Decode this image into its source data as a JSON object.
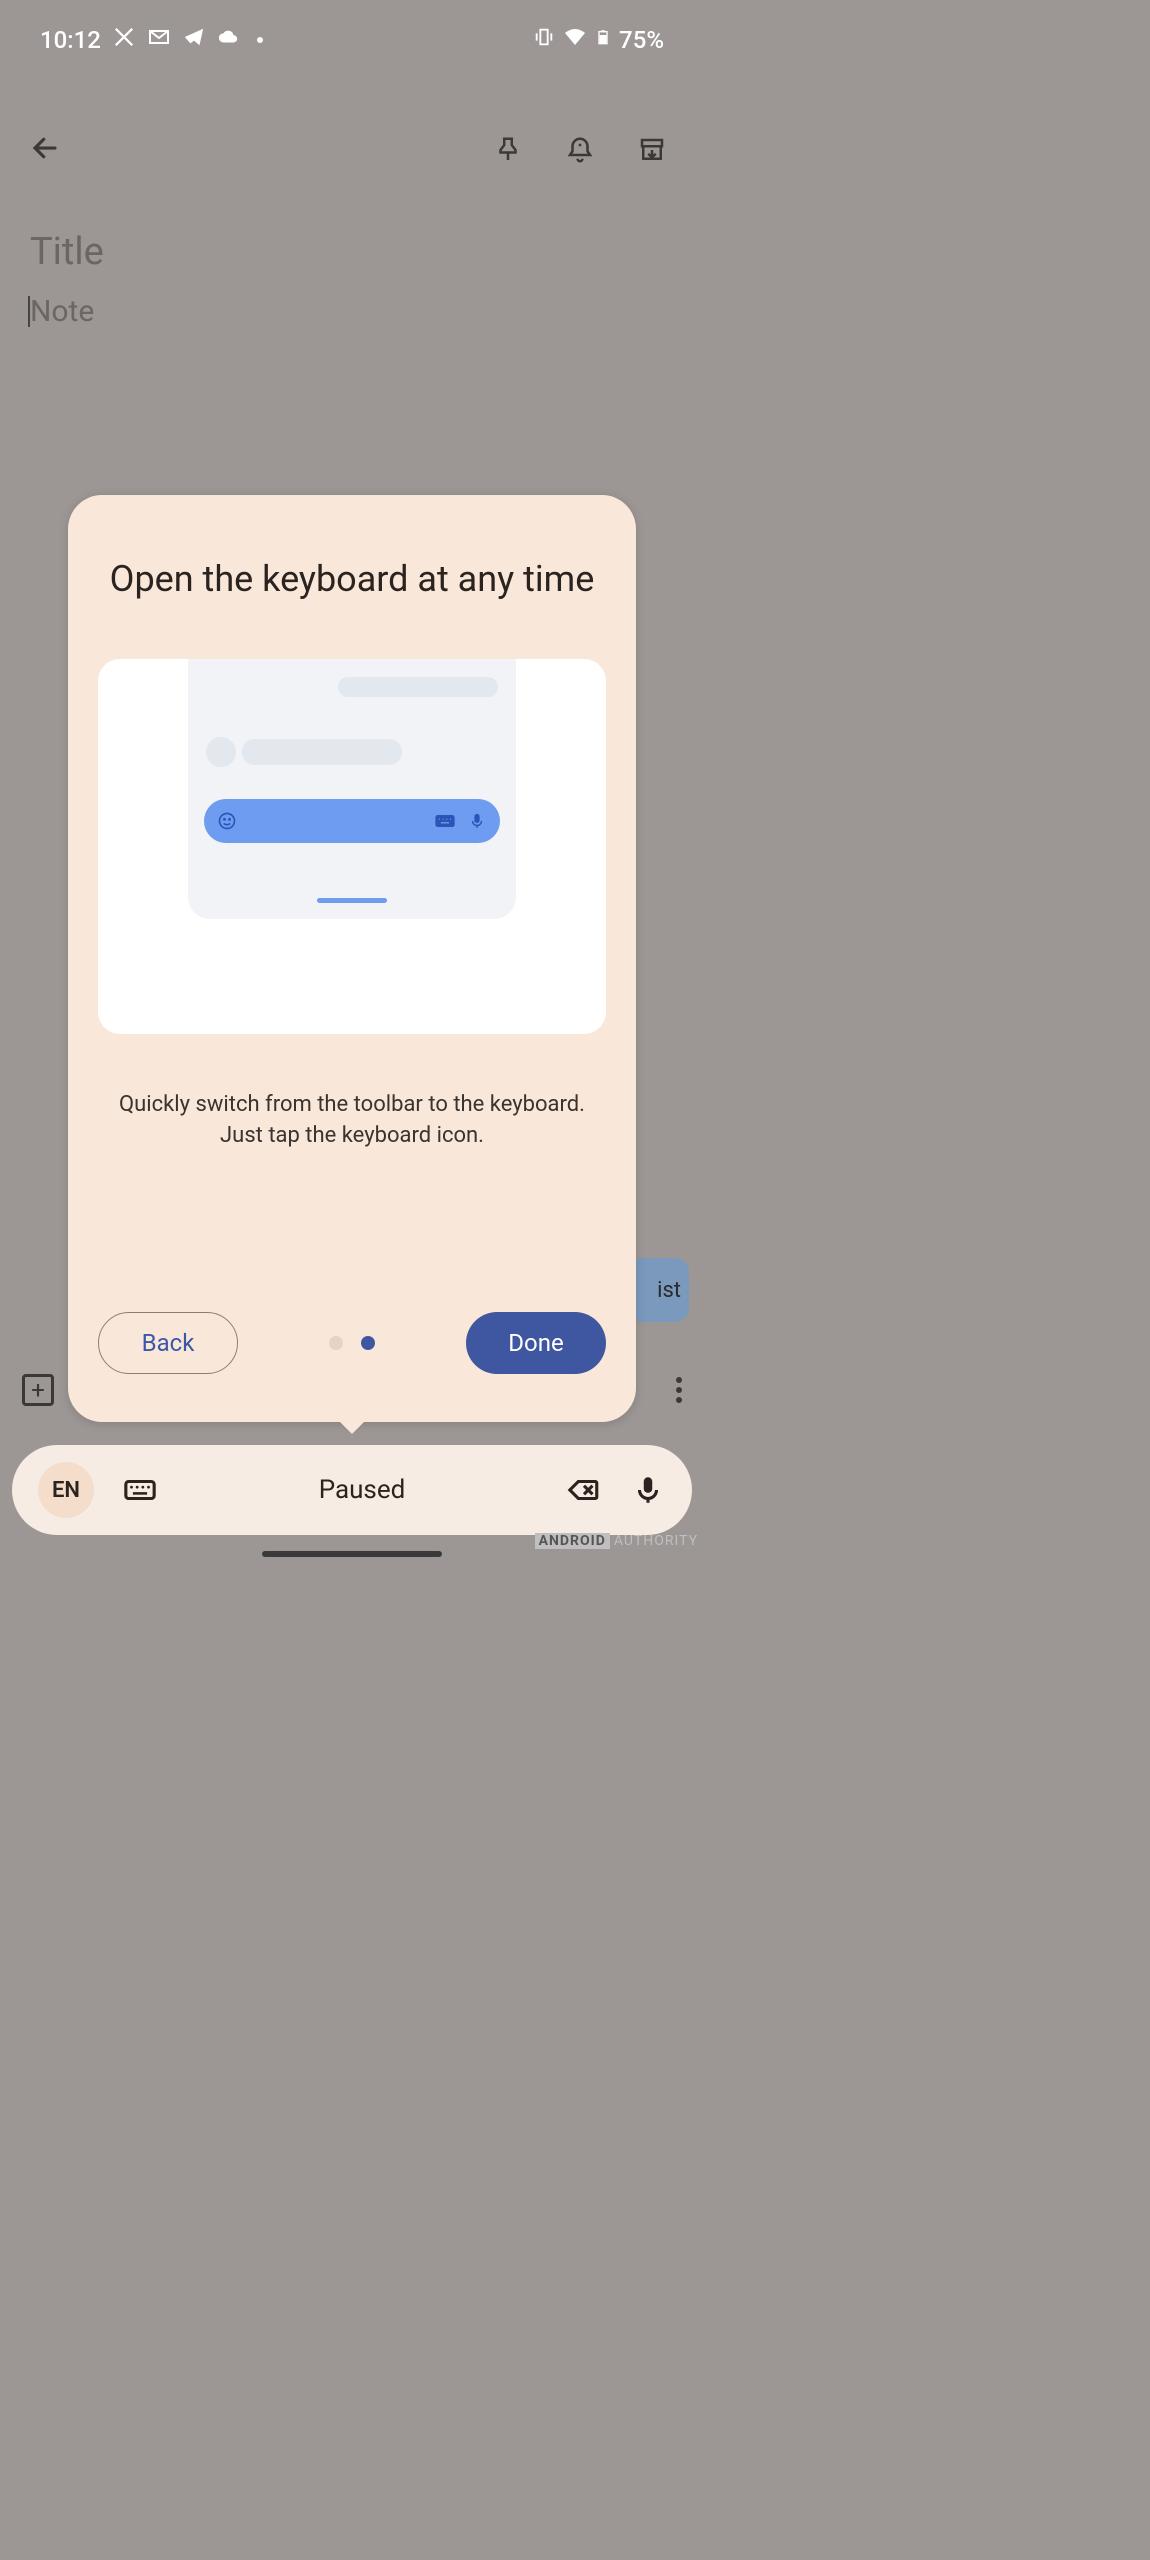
{
  "status": {
    "time": "10:12",
    "battery": "75%"
  },
  "editor": {
    "title_placeholder": "Title",
    "note_placeholder": "Note"
  },
  "dialog": {
    "title": "Open the keyboard at any time",
    "description": "Quickly switch from the toolbar to the keyboard. Just tap the keyboard icon.",
    "back_label": "Back",
    "done_label": "Done",
    "page_index": 1,
    "page_count": 2
  },
  "peek": {
    "text": "ist"
  },
  "gboard": {
    "language": "EN",
    "status": "Paused"
  },
  "watermark": {
    "brand": "ANDROID",
    "word": "AUTHORITY"
  }
}
